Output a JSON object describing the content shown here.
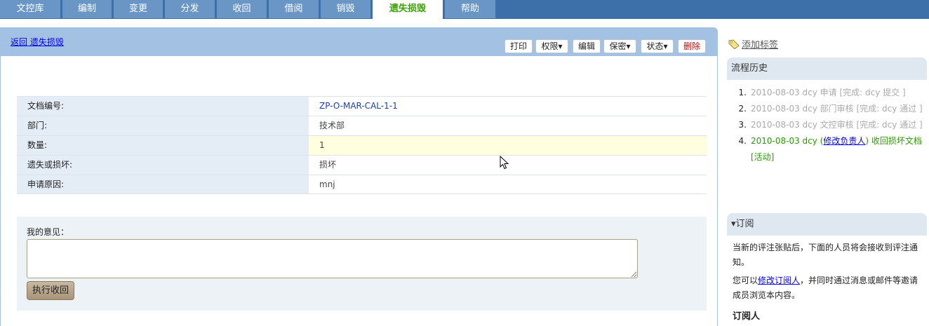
{
  "tabs": [
    {
      "label": "文控库",
      "active": false
    },
    {
      "label": "编制",
      "active": false
    },
    {
      "label": "变更",
      "active": false
    },
    {
      "label": "分发",
      "active": false
    },
    {
      "label": "收回",
      "active": false
    },
    {
      "label": "借阅",
      "active": false
    },
    {
      "label": "销毁",
      "active": false
    },
    {
      "label": "遗失损毁",
      "active": true
    },
    {
      "label": "帮助",
      "active": false
    }
  ],
  "header": {
    "back_link": "返回 遗失损毁"
  },
  "toolbar": {
    "print": "打印",
    "permission": "权限▾",
    "edit": "编辑",
    "secret": "保密▾",
    "status": "状态▾",
    "delete": "删除"
  },
  "details": [
    {
      "label": "文档编号:",
      "value": "ZP-O-MAR-CAL-1-1"
    },
    {
      "label": "部门:",
      "value": "技术部"
    },
    {
      "label": "数量:",
      "value": "1"
    },
    {
      "label": "遗失或损坏:",
      "value": "损坏"
    },
    {
      "label": "申请原因:",
      "value": "mnj"
    }
  ],
  "opinion": {
    "label": "我的意见：",
    "value": "",
    "submit": "执行收回"
  },
  "sidebar": {
    "add_tag": "添加标签",
    "history_title": "流程历史",
    "history": [
      {
        "num": "1.",
        "text": "2010-08-03 dcy 申请 [完成: dcy 提交 ]"
      },
      {
        "num": "2.",
        "text": "2010-08-03 dcy 部门审核 [完成: dcy 通过 ]"
      },
      {
        "num": "3.",
        "text": "2010-08-03 dcy 文控审核 [完成: dcy 通过 ]"
      },
      {
        "num": "4.",
        "pre": "2010-08-03 dcy (",
        "link": "修改负责人",
        "post": ") 收回损坏文档 [活动]"
      }
    ],
    "subscribe_title": "订阅",
    "subscribe_text1": "当新的评注张贴后，下面的人员将会接收到评注通知。",
    "subscribe_text2_pre": "您可以",
    "subscribe_text2_link": "修改订阅人",
    "subscribe_text2_post": "，并同时通过消息或邮件等邀请成员浏览本内容。",
    "subscribers_title": "订阅人"
  },
  "colors": {
    "tabbar": "#3d6fa8",
    "tab": "#6a96c6",
    "active_tab_text": "#37a000",
    "panel_header": "#a3c2e3",
    "history_active": "#2a9a00"
  }
}
